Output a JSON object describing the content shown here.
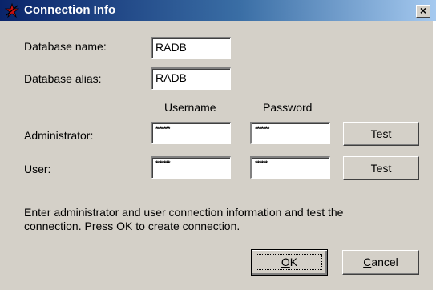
{
  "window": {
    "title": "Connection Info",
    "close_glyph": "×"
  },
  "form": {
    "db_name_label": "Database name:",
    "db_name_value": "RADB",
    "db_alias_label": "Database alias:",
    "db_alias_value": "RADB",
    "col_username": "Username",
    "col_password": "Password",
    "admin_label": "Administrator:",
    "admin_username_masked": "*******",
    "admin_password_masked": "*******",
    "user_label": "User:",
    "user_username_masked": "*******",
    "user_password_masked": "******",
    "test_label": "Test",
    "instructions": "Enter administrator and user connection information and test the connection.  Press OK to create connection."
  },
  "buttons": {
    "ok_label": "OK",
    "ok_mnemonic": "O",
    "ok_rest": "K",
    "cancel_label": "Cancel",
    "cancel_mnemonic": "C",
    "cancel_rest": "ancel"
  },
  "icons": {
    "app": "red-star-icon",
    "close": "close-icon"
  },
  "colors": {
    "title_gradient_start": "#0a246a",
    "title_gradient_end": "#a6caf0",
    "dialog_face": "#d4d0c8"
  }
}
